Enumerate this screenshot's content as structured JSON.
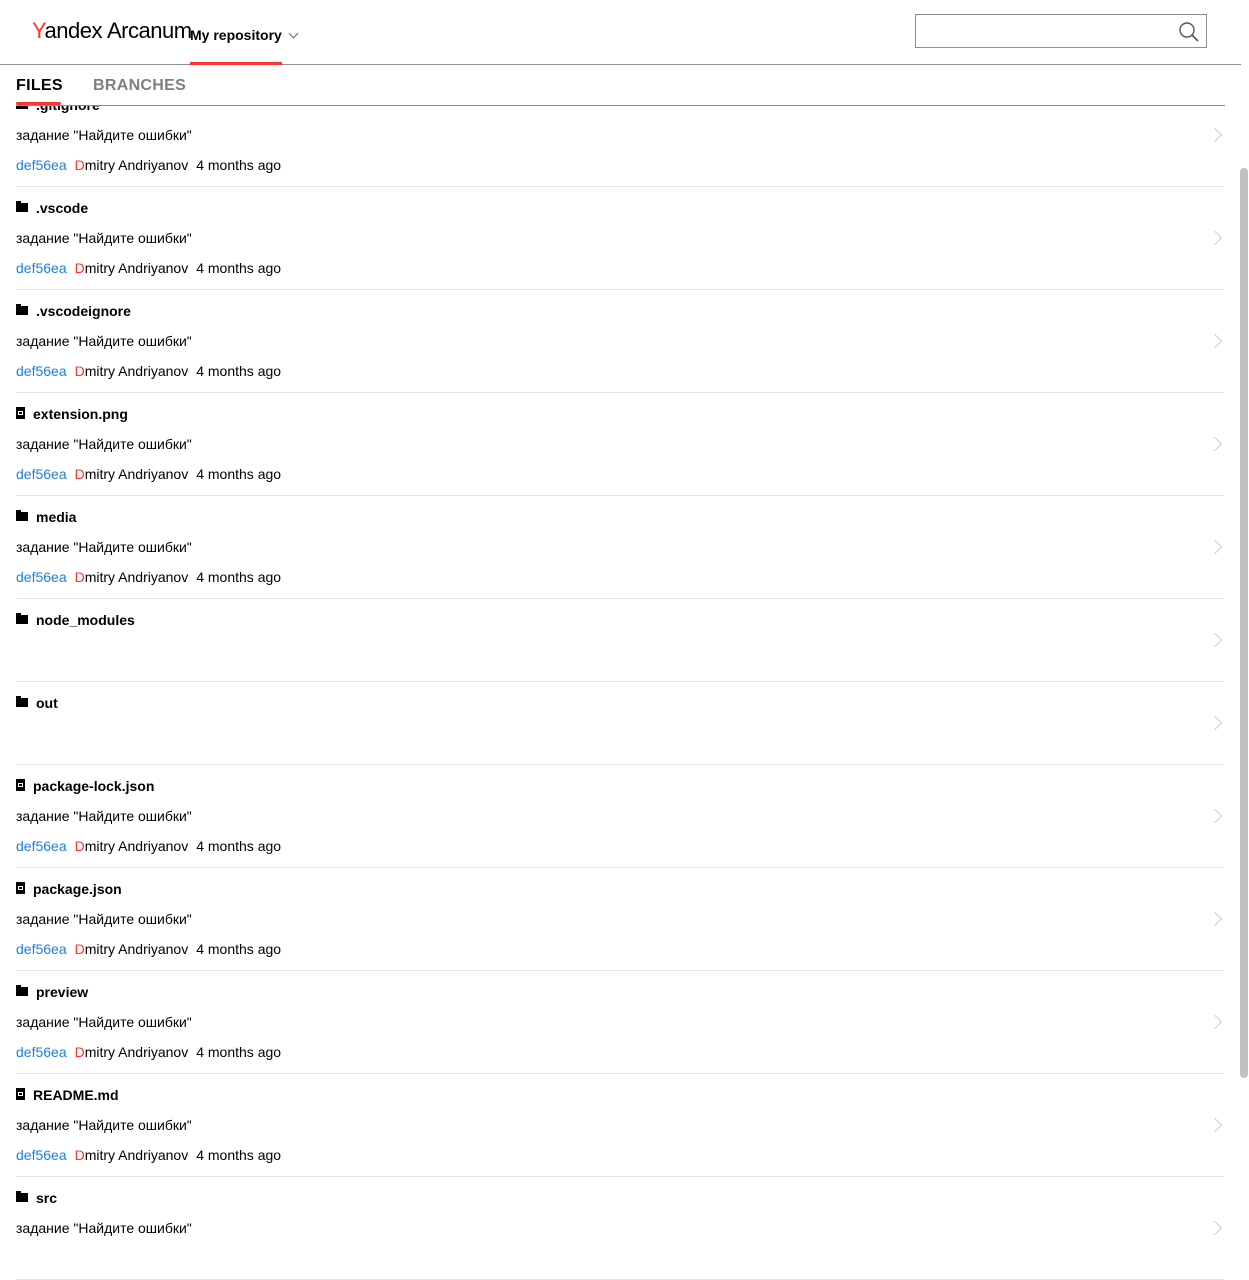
{
  "header": {
    "logo_y": "Y",
    "logo_rest": "andex",
    "logo_product": "Arcanum",
    "repo_label": "My repository",
    "search_placeholder": ""
  },
  "tabs": [
    {
      "label": "FILES",
      "active": true
    },
    {
      "label": "BRANCHES",
      "active": false
    }
  ],
  "rows": [
    {
      "name": ".gitignore",
      "type": "folder",
      "message": "задание \"Найдите ошибки\"",
      "hash": "def56ea",
      "author_first": "D",
      "author_rest": "mitry Andriyanov",
      "time": "4 months ago"
    },
    {
      "name": ".vscode",
      "type": "folder",
      "message": "задание \"Найдите ошибки\"",
      "hash": "def56ea",
      "author_first": "D",
      "author_rest": "mitry Andriyanov",
      "time": "4 months ago"
    },
    {
      "name": ".vscodeignore",
      "type": "folder",
      "message": "задание \"Найдите ошибки\"",
      "hash": "def56ea",
      "author_first": "D",
      "author_rest": "mitry Andriyanov",
      "time": "4 months ago"
    },
    {
      "name": "extension.png",
      "type": "file",
      "message": "задание \"Найдите ошибки\"",
      "hash": "def56ea",
      "author_first": "D",
      "author_rest": "mitry Andriyanov",
      "time": "4 months ago"
    },
    {
      "name": "media",
      "type": "folder",
      "message": "задание \"Найдите ошибки\"",
      "hash": "def56ea",
      "author_first": "D",
      "author_rest": "mitry Andriyanov",
      "time": "4 months ago"
    },
    {
      "name": "node_modules",
      "type": "folder",
      "message": "",
      "hash": "",
      "author_first": "",
      "author_rest": "",
      "time": ""
    },
    {
      "name": "out",
      "type": "folder",
      "message": "",
      "hash": "",
      "author_first": "",
      "author_rest": "",
      "time": ""
    },
    {
      "name": "package-lock.json",
      "type": "file",
      "message": "задание \"Найдите ошибки\"",
      "hash": "def56ea",
      "author_first": "D",
      "author_rest": "mitry Andriyanov",
      "time": "4 months ago"
    },
    {
      "name": "package.json",
      "type": "file",
      "message": "задание \"Найдите ошибки\"",
      "hash": "def56ea",
      "author_first": "D",
      "author_rest": "mitry Andriyanov",
      "time": "4 months ago"
    },
    {
      "name": "preview",
      "type": "folder",
      "message": "задание \"Найдите ошибки\"",
      "hash": "def56ea",
      "author_first": "D",
      "author_rest": "mitry Andriyanov",
      "time": "4 months ago"
    },
    {
      "name": "README.md",
      "type": "file",
      "message": "задание \"Найдите ошибки\"",
      "hash": "def56ea",
      "author_first": "D",
      "author_rest": "mitry Andriyanov",
      "time": "4 months ago"
    },
    {
      "name": "src",
      "type": "folder",
      "message": "задание \"Найдите ошибки\"",
      "hash": "",
      "author_first": "",
      "author_rest": "",
      "time": ""
    }
  ]
}
